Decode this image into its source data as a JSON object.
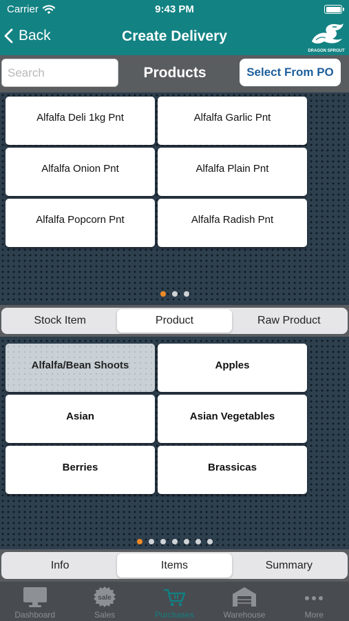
{
  "status_bar": {
    "carrier": "Carrier",
    "time": "9:43 PM"
  },
  "nav": {
    "back_label": "Back",
    "title": "Create Delivery",
    "logo_text": "DRAGON SPROUT"
  },
  "toolbar": {
    "search_placeholder": "Search",
    "search_value": "",
    "heading": "Products",
    "select_po_label": "Select From PO"
  },
  "products": [
    "Alfalfa Deli 1kg Pnt",
    "Alfalfa Garlic Pnt",
    "Alfalfa Onion Pnt",
    "Alfalfa Plain Pnt",
    "Alfalfa Popcorn Pnt",
    "Alfalfa Radish Pnt"
  ],
  "products_pager": {
    "pages": 3,
    "current": 1
  },
  "type_segment": {
    "options": [
      "Stock Item",
      "Product",
      "Raw Product"
    ],
    "selected": "Product"
  },
  "categories": [
    "Alfalfa/Bean Shoots",
    "Apples",
    "Asian",
    "Asian Vegetables",
    "Berries",
    "Brassicas"
  ],
  "selected_category": "Alfalfa/Bean Shoots",
  "categories_pager": {
    "pages": 7,
    "current": 1
  },
  "section_segment": {
    "options": [
      "Info",
      "Items",
      "Summary"
    ],
    "selected": "Items"
  },
  "tab_bar": [
    {
      "label": "Dashboard",
      "icon": "monitor-icon",
      "active": false
    },
    {
      "label": "Sales",
      "icon": "sale-tag-icon",
      "active": false
    },
    {
      "label": "Purchases",
      "icon": "cart-icon",
      "active": true
    },
    {
      "label": "Warehouse",
      "icon": "warehouse-icon",
      "active": false
    },
    {
      "label": "More",
      "icon": "more-icon",
      "active": false
    }
  ],
  "colors": {
    "teal": "#138283",
    "toolbar_gray": "#5a5d60",
    "accent_orange": "#f08a24",
    "link_blue": "#1e5f9c"
  }
}
